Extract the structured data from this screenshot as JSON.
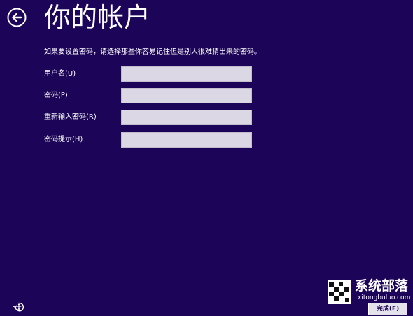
{
  "header": {
    "title": "你的帐户",
    "back_icon": "back-arrow-icon"
  },
  "instructions": "如果要设置密码，请选择那些你容易记住但是别人很难猜出来的密码。",
  "form": {
    "fields": [
      {
        "label": "用户名(U)",
        "value": ""
      },
      {
        "label": "密码(P)",
        "value": ""
      },
      {
        "label": "重新输入密码(R)",
        "value": ""
      },
      {
        "label": "密码提示(H)",
        "value": ""
      }
    ]
  },
  "footer": {
    "ease_of_access_icon": "ease-of-access-icon",
    "finish_label": "完成(F)"
  },
  "watermark": {
    "name": "系统部落",
    "url": "xitongbuluo.com"
  },
  "colors": {
    "background": "#1c0558",
    "input_fill": "#dcd7e4",
    "text": "#ffffff"
  }
}
